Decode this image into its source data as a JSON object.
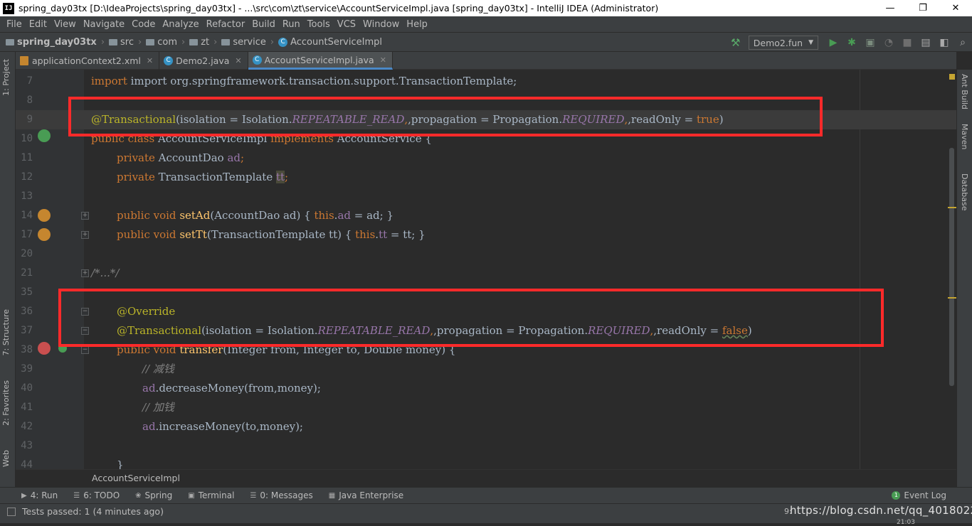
{
  "window": {
    "app_icon": "IJ",
    "title": "spring_day03tx [D:\\IdeaProjects\\spring_day03tx] - ...\\src\\com\\zt\\service\\AccountServiceImpl.java [spring_day03tx] - IntelliJ IDEA (Administrator)",
    "minimize": "—",
    "maximize": "❐",
    "close": "✕"
  },
  "menu": [
    "File",
    "Edit",
    "View",
    "Navigate",
    "Code",
    "Analyze",
    "Refactor",
    "Build",
    "Run",
    "Tools",
    "VCS",
    "Window",
    "Help"
  ],
  "breadcrumbs": {
    "project": "spring_day03tx",
    "items": [
      "src",
      "com",
      "zt",
      "service"
    ],
    "file": "AccountServiceImpl"
  },
  "toolbar": {
    "run_config": "Demo2.fun",
    "hammer_icon": "hammer-icon",
    "dropdown_arrow": "▼"
  },
  "tabs": [
    {
      "label": "applicationContext2.xml",
      "active": false
    },
    {
      "label": "Demo2.java",
      "active": false
    },
    {
      "label": "AccountServiceImpl.java",
      "active": true
    }
  ],
  "left_tool_tabs": [
    "1: Project",
    "7: Structure",
    "2: Favorites",
    "Web"
  ],
  "right_tool_tabs": [
    "Ant Build",
    "Maven",
    "Database"
  ],
  "lines": [
    {
      "num": "7"
    },
    {
      "num": "8"
    },
    {
      "num": "9"
    },
    {
      "num": "10"
    },
    {
      "num": "11"
    },
    {
      "num": "12"
    },
    {
      "num": "13"
    },
    {
      "num": "14"
    },
    {
      "num": "17"
    },
    {
      "num": "20"
    },
    {
      "num": "21"
    },
    {
      "num": "35"
    },
    {
      "num": "36"
    },
    {
      "num": "37"
    },
    {
      "num": "38"
    },
    {
      "num": "39"
    },
    {
      "num": "40"
    },
    {
      "num": "41"
    },
    {
      "num": "42"
    },
    {
      "num": "43"
    },
    {
      "num": "44"
    }
  ],
  "code": {
    "l7": "import org.springframework.transaction.support.TransactionTemplate;",
    "l9_ann": "@Transactional",
    "l9_a": "(isolation = Isolation.",
    "l9_b": "REPEATABLE_READ",
    "l9_c": ",propagation = Propagation.",
    "l9_d": "REQUIRED",
    "l9_e": ",readOnly = ",
    "l9_f": "true",
    "l9_g": ")",
    "l10_kw": "public class ",
    "l10_a": "AccountServiceImpl ",
    "l10_kw2": "implements ",
    "l10_b": "AccountService {",
    "l11_kw": "private ",
    "l11_a": "AccountDao ",
    "l11_f": "ad",
    "l11_s": ";",
    "l12_kw": "private ",
    "l12_a": "TransactionTemplate ",
    "l12_f": "tt",
    "l12_s": ";",
    "l14_kw": "public void ",
    "l14_m": "setAd",
    "l14_a": "(AccountDao ad) ",
    "l14_b": "{ ",
    "l14_kw2": "this",
    "l14_c": ".",
    "l14_f": "ad",
    "l14_d": " = ad; }",
    "l17_kw": "public void ",
    "l17_m": "setTt",
    "l17_a": "(TransactionTemplate tt) ",
    "l17_b": "{ ",
    "l17_kw2": "this",
    "l17_c": ".",
    "l17_f": "tt",
    "l17_d": " = tt; }",
    "l21": "/*...*/",
    "l36": "@Override",
    "l37_ann": "@Transactional",
    "l37_a": "(isolation = Isolation.",
    "l37_b": "REPEATABLE_READ",
    "l37_c": ",propagation = Propagation.",
    "l37_d": "REQUIRED",
    "l37_e": ",readOnly = ",
    "l37_f": "false",
    "l37_g": ")",
    "l38_kw": "public void ",
    "l38_m": "transfer",
    "l38_a": "(Integer from, Integer to, Double money) {",
    "l39": "// 减钱",
    "l40_f": "ad",
    "l40_a": ".decreaseMoney(from,money);",
    "l41": "// 加钱",
    "l42_f": "ad",
    "l42_a": ".increaseMoney(to,money);",
    "l44": "}"
  },
  "bottom_breadcrumb": "AccountServiceImpl",
  "tool_windows": [
    {
      "label": "4: Run",
      "icon": "▶"
    },
    {
      "label": "6: TODO",
      "icon": "☰"
    },
    {
      "label": "Spring",
      "icon": "❀"
    },
    {
      "label": "Terminal",
      "icon": "▣"
    },
    {
      "label": "0: Messages",
      "icon": "☰"
    },
    {
      "label": "Java Enterprise",
      "icon": "▦"
    }
  ],
  "event_log": "Event Log",
  "status": {
    "message": "Tests passed: 1 (4 minutes ago)",
    "position": "9:",
    "watermark": "https://blog.csdn.net/qq_40180229",
    "clock": "21:03"
  },
  "colors": {
    "highlight_box": "#ff2a2a",
    "keyword": "#cc7832",
    "annotation": "#bbb529",
    "field": "#9876aa",
    "method": "#ffc66d"
  }
}
